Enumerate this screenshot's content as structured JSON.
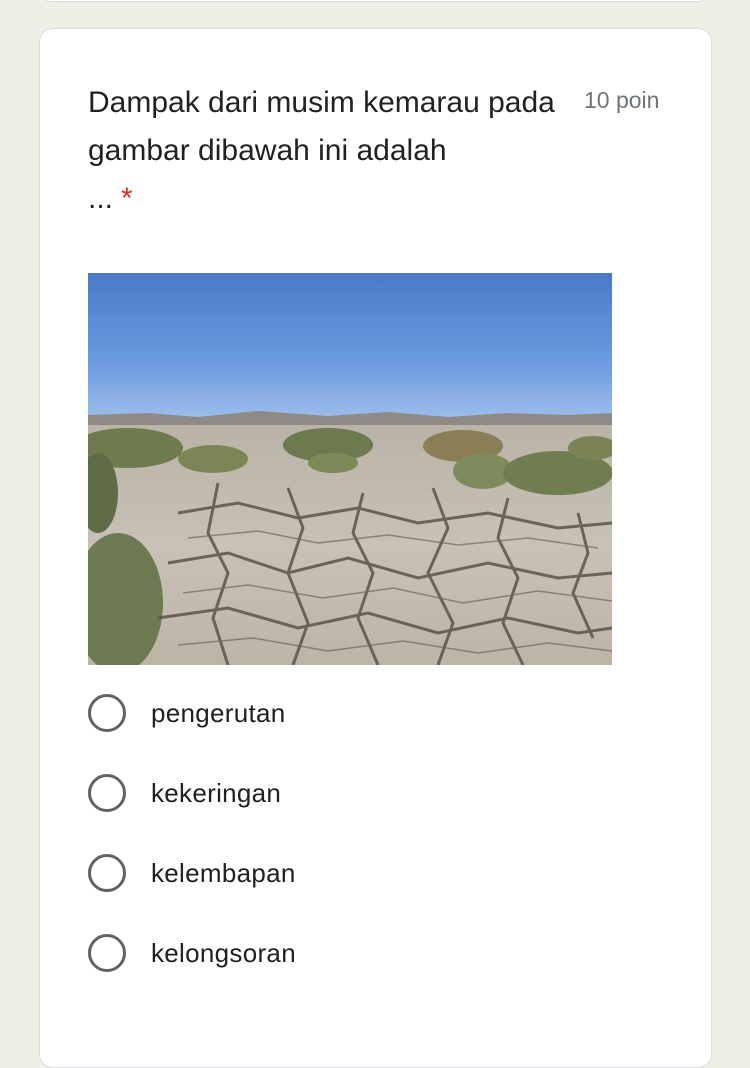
{
  "question": {
    "title_line": "Dampak dari musim kemarau pada gambar dibawah ini adalah",
    "ellipsis": "...",
    "required_marker": "*",
    "points": "10 poin"
  },
  "image": {
    "subject": "cracked dry earth under clear blue sky with dry shrubs"
  },
  "options": [
    {
      "label": "pengerutan"
    },
    {
      "label": "kekeringan"
    },
    {
      "label": "kelembapan"
    },
    {
      "label": "kelongsoran"
    }
  ],
  "colors": {
    "page_background": "#efefe8",
    "card_background": "#ffffff",
    "required_red": "#d93025",
    "radio_border": "#5f6368",
    "points_gray": "#70757a"
  }
}
